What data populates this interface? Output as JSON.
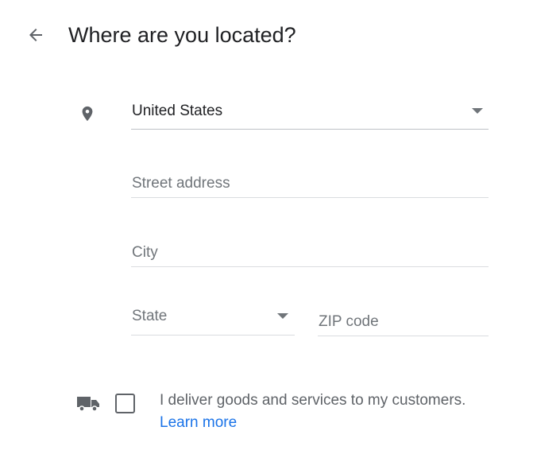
{
  "header": {
    "back_icon": "arrow-back-icon",
    "title": "Where are you located?"
  },
  "form": {
    "location_icon": "map-pin-icon",
    "country": {
      "value": "United States",
      "caret_icon": "dropdown-caret-icon"
    },
    "street_address": {
      "placeholder": "Street address",
      "value": ""
    },
    "city": {
      "placeholder": "City",
      "value": ""
    },
    "state": {
      "placeholder": "State",
      "value": "",
      "caret_icon": "dropdown-caret-icon"
    },
    "zip": {
      "placeholder": "ZIP code",
      "value": ""
    }
  },
  "delivery": {
    "icon": "truck-icon",
    "checked": false,
    "label": "I deliver goods and services to my customers.",
    "link_text": "Learn more"
  },
  "colors": {
    "text_primary": "#202124",
    "text_secondary": "#5f6368",
    "placeholder": "#70757a",
    "link": "#1a73e8",
    "divider": "#dadce0"
  }
}
